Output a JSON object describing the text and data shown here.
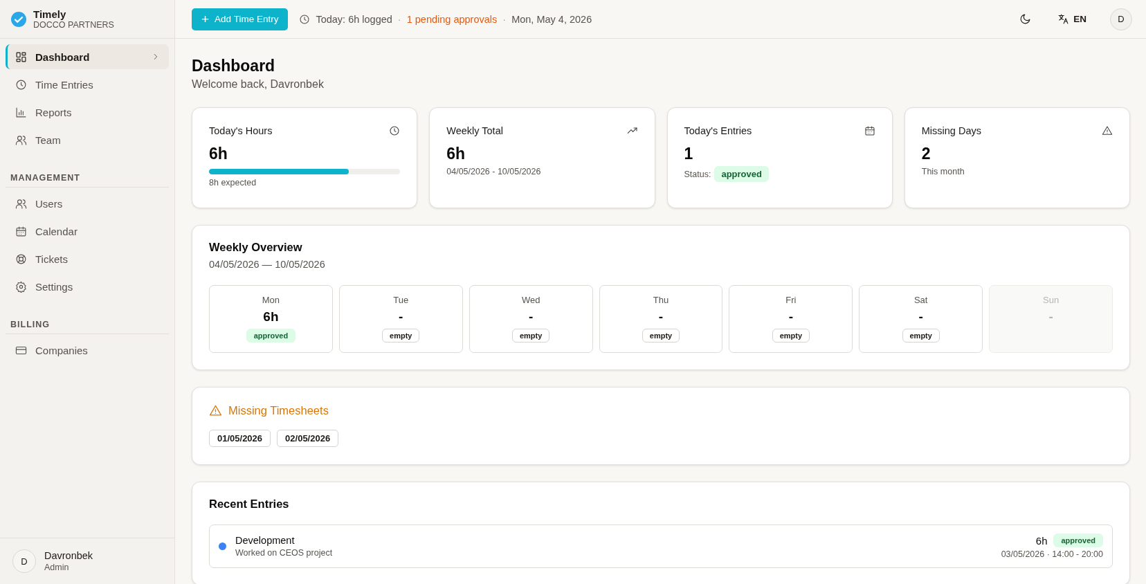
{
  "app": {
    "name": "Timely",
    "org": "DOCCO PARTNERS"
  },
  "sidebar": {
    "sections": [
      {
        "items": [
          {
            "label": "Dashboard",
            "selected": true
          },
          {
            "label": "Time Entries",
            "selected": false
          },
          {
            "label": "Reports",
            "selected": false
          },
          {
            "label": "Team",
            "selected": false
          }
        ]
      },
      {
        "heading": "MANAGEMENT",
        "items": [
          {
            "label": "Users",
            "selected": false
          },
          {
            "label": "Calendar",
            "selected": false
          },
          {
            "label": "Tickets",
            "selected": false
          },
          {
            "label": "Settings",
            "selected": false
          }
        ]
      },
      {
        "heading": "BILLING",
        "items": [
          {
            "label": "Companies",
            "selected": false
          }
        ]
      }
    ]
  },
  "user": {
    "initial": "D",
    "name": "Davronbek",
    "role": "Admin"
  },
  "header": {
    "add_button": "+",
    "add_label": "Add Time Entry",
    "today": "Today: 6h logged",
    "separator_1": "·",
    "pending": "1 pending approvals",
    "separator_2": "·",
    "date": "Mon, May 4, 2026",
    "language": "EN",
    "avatar": "D"
  },
  "page": {
    "title": "Dashboard",
    "subtitle": "Welcome back, Davronbek"
  },
  "stats": [
    {
      "kind": "progress",
      "title": "Today's Hours",
      "value": "6h",
      "level": 0.73,
      "caption": "8h expected"
    },
    {
      "kind": "caption",
      "title": "Weekly Total",
      "value": "6h",
      "caption": "04/05/2026 - 10/05/2026"
    },
    {
      "kind": "status",
      "title": "Today's Entries",
      "value": "1",
      "caption": "Status:",
      "badge": {
        "text": "approved",
        "kind": "approved"
      }
    },
    {
      "kind": "caption",
      "title": "Missing Days",
      "value": "2",
      "caption": "This month"
    }
  ],
  "weekly": {
    "title": "Weekly Overview",
    "range": "04/05/2026 — 10/05/2026",
    "days": [
      {
        "day": "Mon",
        "value": "6h",
        "badge": {
          "text": "approved",
          "kind": "approved"
        },
        "disabled": false
      },
      {
        "day": "Tue",
        "value": "-",
        "badge": {
          "text": "empty",
          "kind": "empty"
        },
        "disabled": false
      },
      {
        "day": "Wed",
        "value": "-",
        "badge": {
          "text": "empty",
          "kind": "empty"
        },
        "disabled": false
      },
      {
        "day": "Thu",
        "value": "-",
        "badge": {
          "text": "empty",
          "kind": "empty"
        },
        "disabled": false
      },
      {
        "day": "Fri",
        "value": "-",
        "badge": {
          "text": "empty",
          "kind": "empty"
        },
        "disabled": false
      },
      {
        "day": "Sat",
        "value": "-",
        "badge": {
          "text": "empty",
          "kind": "empty"
        },
        "disabled": false
      },
      {
        "day": "Sun",
        "value": "-",
        "disabled": true
      }
    ]
  },
  "missing": {
    "title": "Missing Timesheets",
    "dates": [
      "01/05/2026",
      "02/05/2026"
    ]
  },
  "recent": {
    "title": "Recent Entries",
    "entries": [
      {
        "project": "Development",
        "description": "Worked on CEOS project",
        "hours": "6h",
        "badge": {
          "text": "approved",
          "kind": "approved"
        },
        "when": "03/05/2026 · 14:00 - 20:00",
        "color": "#3b82f6"
      }
    ]
  }
}
